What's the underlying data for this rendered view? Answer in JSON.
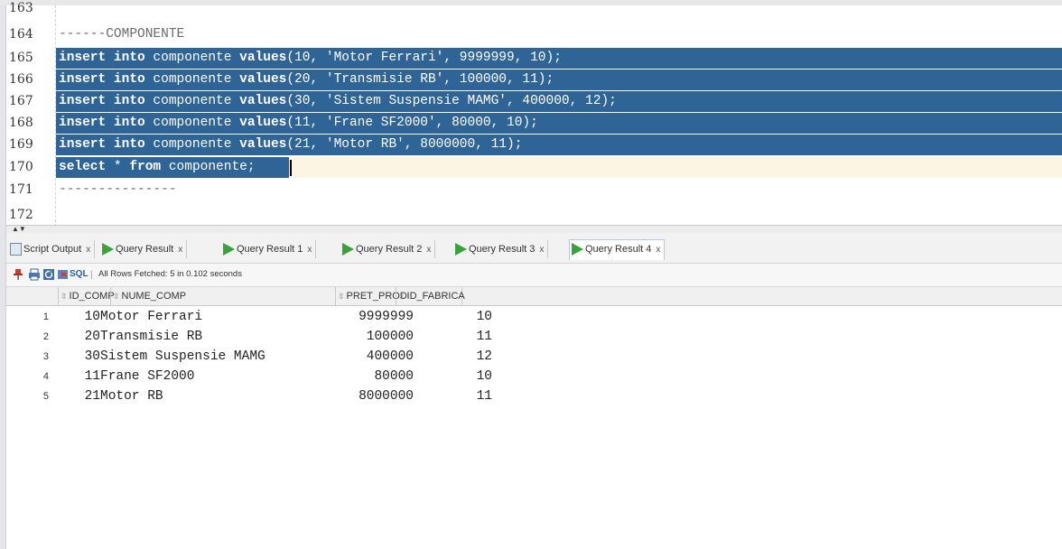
{
  "editor": {
    "lines": [
      {
        "num": "163",
        "text": ""
      },
      {
        "num": "164",
        "text": "------COMPONENTE"
      },
      {
        "num": "165",
        "kw1": "insert into",
        "mid": " componente ",
        "kw2": "values",
        "rest": "(10, 'Motor Ferrari', 9999999, 10);"
      },
      {
        "num": "166",
        "kw1": "insert into",
        "mid": " componente ",
        "kw2": "values",
        "rest": "(20, 'Transmisie RB', 100000, 11);"
      },
      {
        "num": "167",
        "kw1": "insert into",
        "mid": " componente ",
        "kw2": "values",
        "rest": "(30, 'Sistem Suspensie MAMG', 400000, 12);"
      },
      {
        "num": "168",
        "kw1": "insert into",
        "mid": " componente ",
        "kw2": "values",
        "rest": "(11, 'Frane SF2000', 80000, 10);"
      },
      {
        "num": "169",
        "kw1": "insert into",
        "mid": " componente ",
        "kw2": "values",
        "rest": "(21, 'Motor RB', 8000000, 11);"
      },
      {
        "num": "170",
        "kw1": "select",
        "star": " * ",
        "kw2": "from",
        "rest": " componente;"
      },
      {
        "num": "171",
        "text": "---------------"
      },
      {
        "num": "172",
        "text": ""
      }
    ]
  },
  "tabs": [
    {
      "label": "Script Output",
      "icon": "script-output-icon",
      "close": "x"
    },
    {
      "label": "Query Result",
      "icon": "query-result-icon",
      "close": "x"
    },
    {
      "label": "Query Result 1",
      "icon": "query-result-icon",
      "close": "x"
    },
    {
      "label": "Query Result 2",
      "icon": "query-result-icon",
      "close": "x"
    },
    {
      "label": "Query Result 3",
      "icon": "query-result-icon",
      "close": "x"
    },
    {
      "label": "Query Result 4",
      "icon": "query-result-icon",
      "close": "x"
    }
  ],
  "toolbar": {
    "sql_label": "SQL",
    "separator": "|",
    "status": "All Rows Fetched: 5 in 0.102 seconds"
  },
  "grid": {
    "columns": [
      "ID_COMP",
      "NUME_COMP",
      "PRET_PROD",
      "ID_FABRICA"
    ],
    "rows": [
      {
        "rn": "1",
        "id_comp": "10",
        "nume_comp": "Motor Ferrari",
        "pret_prod": "9999999",
        "id_fabrica": "10"
      },
      {
        "rn": "2",
        "id_comp": "20",
        "nume_comp": "Transmisie RB",
        "pret_prod": "100000",
        "id_fabrica": "11"
      },
      {
        "rn": "3",
        "id_comp": "30",
        "nume_comp": "Sistem Suspensie MAMG",
        "pret_prod": "400000",
        "id_fabrica": "12"
      },
      {
        "rn": "4",
        "id_comp": "11",
        "nume_comp": "Frane SF2000",
        "pret_prod": "80000",
        "id_fabrica": "10"
      },
      {
        "rn": "5",
        "id_comp": "21",
        "nume_comp": "Motor RB",
        "pret_prod": "8000000",
        "id_fabrica": "11"
      }
    ]
  },
  "colors": {
    "selection": "#2f6496",
    "current_line": "#fbf6e4",
    "run_green": "#3aa23a"
  }
}
